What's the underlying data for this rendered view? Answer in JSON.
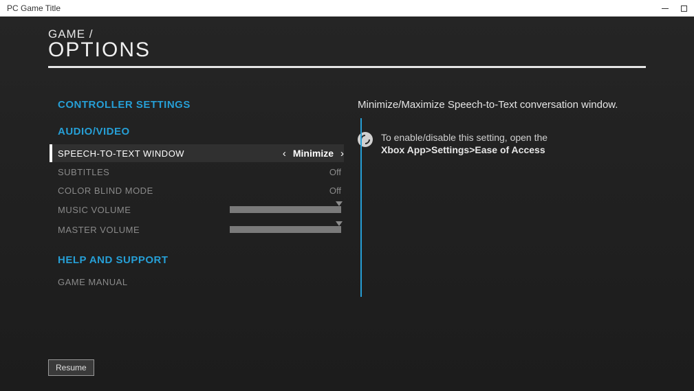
{
  "window": {
    "title": "PC Game Title"
  },
  "header": {
    "breadcrumb": "GAME  /",
    "title": "OPTIONS"
  },
  "sections": {
    "controller": {
      "title": "CONTROLLER SETTINGS"
    },
    "av": {
      "title": "AUDIO/VIDEO",
      "stt": {
        "label": "SPEECH-TO-TEXT WINDOW",
        "value": "Minimize"
      },
      "subtitles": {
        "label": "SUBTITLES",
        "value": "Off"
      },
      "colorblind": {
        "label": "COLOR BLIND MODE",
        "value": "Off"
      },
      "music": {
        "label": "MUSIC VOLUME",
        "value": 100
      },
      "master": {
        "label": "MASTER VOLUME",
        "value": 100
      }
    },
    "help": {
      "title": "HELP AND SUPPORT",
      "manual": {
        "label": "GAME MANUAL"
      }
    }
  },
  "description": {
    "text": "Minimize/Maximize Speech-to-Text conversation window.",
    "hint_prefix": "To enable/disable this setting, open the",
    "hint_path": "Xbox App>Settings>Ease of Access"
  },
  "footer": {
    "resume": "Resume"
  }
}
